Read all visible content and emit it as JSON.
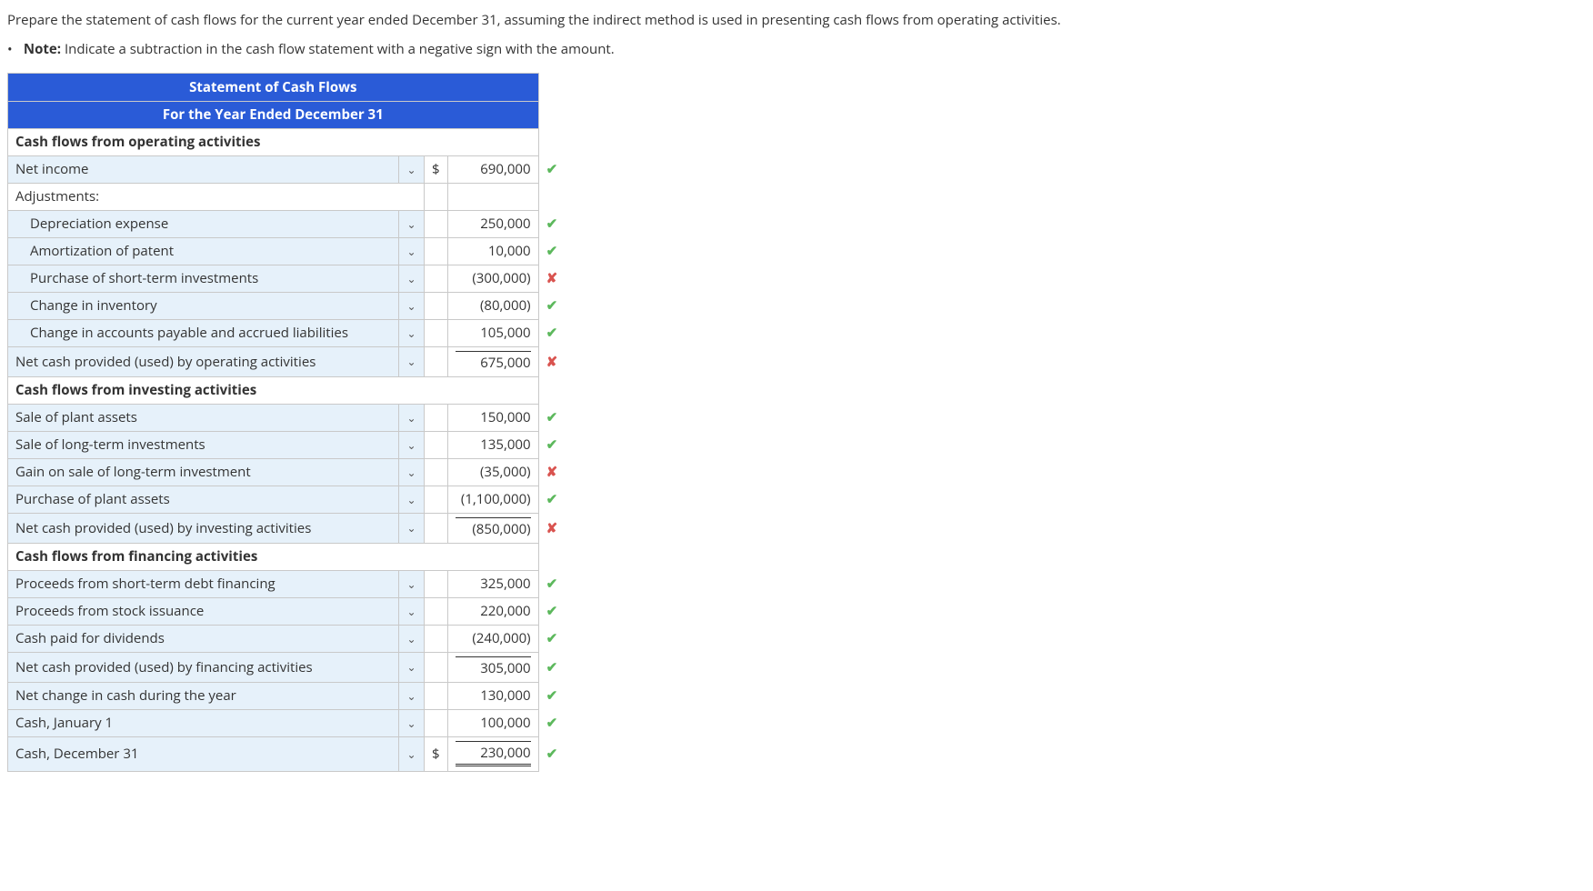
{
  "instructions": {
    "main": "Prepare the statement of cash flows for the current year ended December 31, assuming the indirect method is used in presenting cash flows from operating activities.",
    "note_label": "Note:",
    "note_text": " Indicate a subtraction in the cash flow statement with a negative sign with the amount."
  },
  "table": {
    "title1": "Statement of Cash Flows",
    "title2": "For the Year Ended December 31",
    "rows": [
      {
        "type": "section",
        "label": "Cash flows from operating activities"
      },
      {
        "type": "line",
        "label": "Net income",
        "chevron": true,
        "dollar": "$",
        "amount": "690,000",
        "mark": "check"
      },
      {
        "type": "plain",
        "label": "Adjustments:"
      },
      {
        "type": "line",
        "label": "Depreciation expense",
        "indent": true,
        "chevron": true,
        "amount": "250,000",
        "mark": "check"
      },
      {
        "type": "line",
        "label": "Amortization of patent",
        "indent": true,
        "chevron": true,
        "amount": "10,000",
        "mark": "check"
      },
      {
        "type": "line",
        "label": "Purchase of short-term investments",
        "indent": true,
        "chevron": true,
        "amount": "(300,000)",
        "mark": "cross"
      },
      {
        "type": "line",
        "label": "Change in inventory",
        "indent": true,
        "chevron": true,
        "amount": "(80,000)",
        "mark": "check"
      },
      {
        "type": "line",
        "label": "Change in accounts payable and accrued liabilities",
        "indent": true,
        "chevron": true,
        "amount": "105,000",
        "mark": "check"
      },
      {
        "type": "line",
        "label": "Net cash provided (used) by operating activities",
        "chevron": true,
        "amount": "675,000",
        "mark": "cross",
        "sum": "single"
      },
      {
        "type": "section",
        "label": "Cash flows from investing activities"
      },
      {
        "type": "line",
        "label": "Sale of plant assets",
        "chevron": true,
        "amount": "150,000",
        "mark": "check"
      },
      {
        "type": "line",
        "label": "Sale of long-term investments",
        "chevron": true,
        "amount": "135,000",
        "mark": "check"
      },
      {
        "type": "line",
        "label": "Gain on sale of long-term investment",
        "chevron": true,
        "amount": "(35,000)",
        "mark": "cross"
      },
      {
        "type": "line",
        "label": "Purchase of plant assets",
        "chevron": true,
        "amount": "(1,100,000)",
        "mark": "check"
      },
      {
        "type": "line",
        "label": "Net cash provided (used) by investing activities",
        "chevron": true,
        "amount": "(850,000)",
        "mark": "cross",
        "sum": "single"
      },
      {
        "type": "section",
        "label": "Cash flows from financing activities"
      },
      {
        "type": "line",
        "label": "Proceeds from short-term debt financing",
        "chevron": true,
        "amount": "325,000",
        "mark": "check"
      },
      {
        "type": "line",
        "label": "Proceeds from stock issuance",
        "chevron": true,
        "amount": "220,000",
        "mark": "check"
      },
      {
        "type": "line",
        "label": "Cash paid for dividends",
        "chevron": true,
        "amount": "(240,000)",
        "mark": "check"
      },
      {
        "type": "line",
        "label": "Net cash provided (used) by financing activities",
        "chevron": true,
        "amount": "305,000",
        "mark": "check",
        "sum": "single"
      },
      {
        "type": "line",
        "label": "Net change in cash during the year",
        "chevron": true,
        "amount": "130,000",
        "mark": "check"
      },
      {
        "type": "line",
        "label": "Cash, January 1",
        "chevron": true,
        "amount": "100,000",
        "mark": "check"
      },
      {
        "type": "line",
        "label": "Cash, December 31",
        "chevron": true,
        "dollar": "$",
        "amount": "230,000",
        "mark": "check",
        "sum": "double"
      }
    ]
  },
  "chart_data": {
    "type": "table",
    "title": "Statement of Cash Flows — For the Year Ended December 31",
    "sections": [
      {
        "name": "Cash flows from operating activities",
        "lines": [
          {
            "label": "Net income",
            "value": 690000,
            "correct": true
          },
          {
            "label": "Depreciation expense",
            "value": 250000,
            "correct": true
          },
          {
            "label": "Amortization of patent",
            "value": 10000,
            "correct": true
          },
          {
            "label": "Purchase of short-term investments",
            "value": -300000,
            "correct": false
          },
          {
            "label": "Change in inventory",
            "value": -80000,
            "correct": true
          },
          {
            "label": "Change in accounts payable and accrued liabilities",
            "value": 105000,
            "correct": true
          }
        ],
        "subtotal": {
          "label": "Net cash provided (used) by operating activities",
          "value": 675000,
          "correct": false
        }
      },
      {
        "name": "Cash flows from investing activities",
        "lines": [
          {
            "label": "Sale of plant assets",
            "value": 150000,
            "correct": true
          },
          {
            "label": "Sale of long-term investments",
            "value": 135000,
            "correct": true
          },
          {
            "label": "Gain on sale of long-term investment",
            "value": -35000,
            "correct": false
          },
          {
            "label": "Purchase of plant assets",
            "value": -1100000,
            "correct": true
          }
        ],
        "subtotal": {
          "label": "Net cash provided (used) by investing activities",
          "value": -850000,
          "correct": false
        }
      },
      {
        "name": "Cash flows from financing activities",
        "lines": [
          {
            "label": "Proceeds from short-term debt financing",
            "value": 325000,
            "correct": true
          },
          {
            "label": "Proceeds from stock issuance",
            "value": 220000,
            "correct": true
          },
          {
            "label": "Cash paid for dividends",
            "value": -240000,
            "correct": true
          }
        ],
        "subtotal": {
          "label": "Net cash provided (used) by financing activities",
          "value": 305000,
          "correct": true
        }
      }
    ],
    "totals": [
      {
        "label": "Net change in cash during the year",
        "value": 130000,
        "correct": true
      },
      {
        "label": "Cash, January 1",
        "value": 100000,
        "correct": true
      },
      {
        "label": "Cash, December 31",
        "value": 230000,
        "correct": true
      }
    ]
  }
}
